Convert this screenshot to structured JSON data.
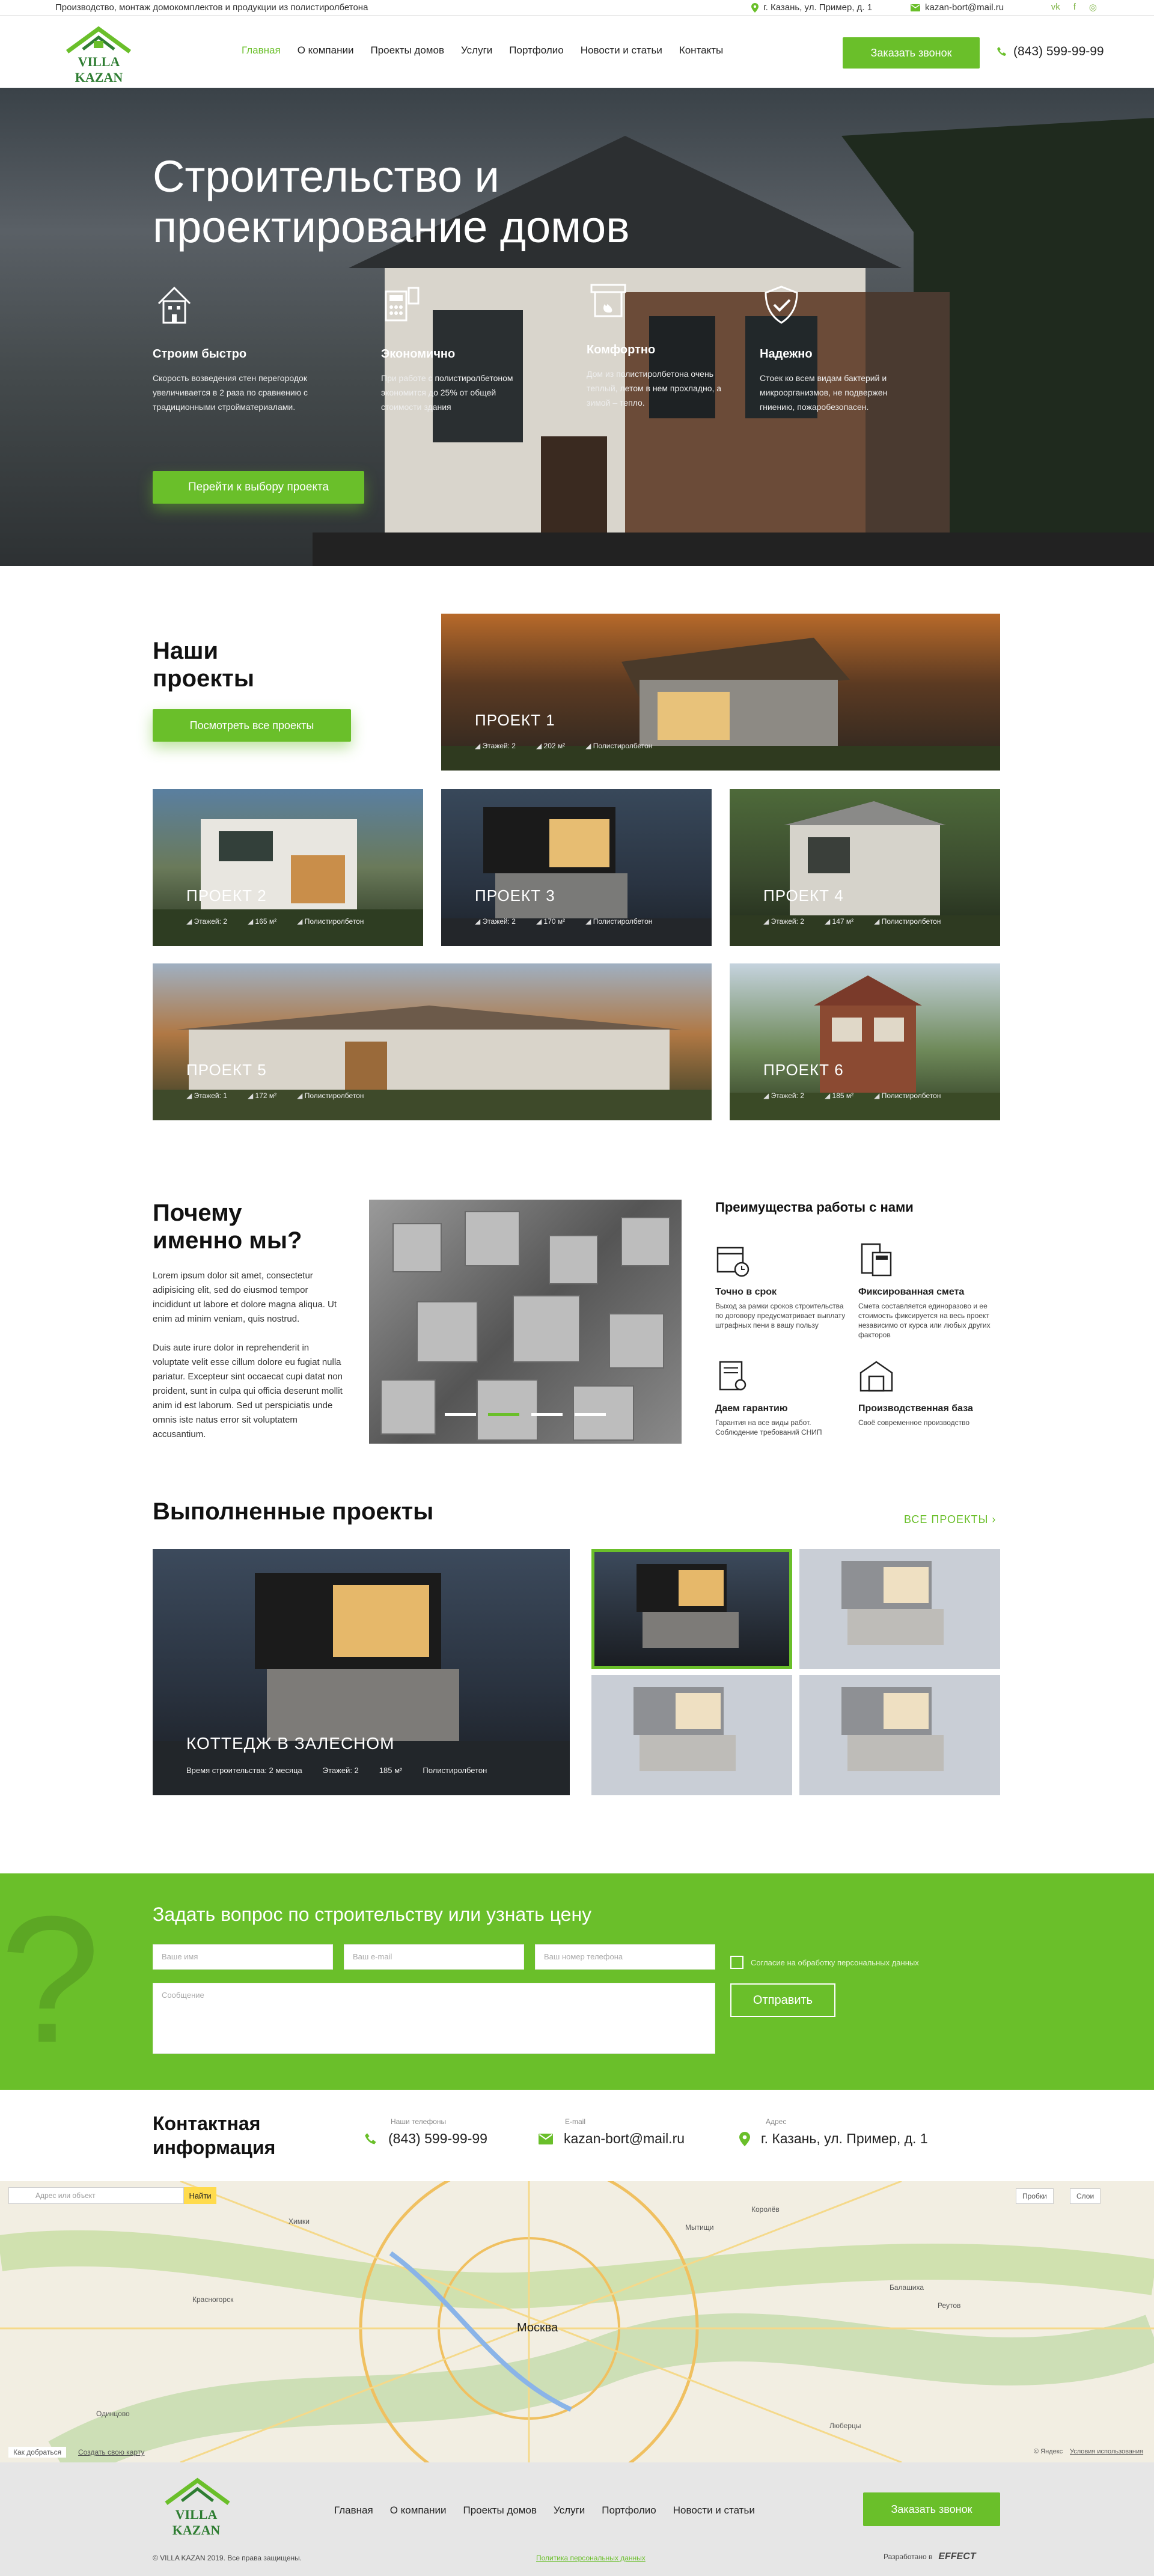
{
  "topbar": {
    "tagline": "Производство, монтаж домокомплектов и продукции из полистиролбетона",
    "address": "г. Казань, ул. Пример, д. 1",
    "email": "kazan-bort@mail.ru",
    "socials": [
      "vk-icon",
      "facebook-icon",
      "instagram-icon"
    ]
  },
  "header": {
    "logo": "VILLA KAZAN",
    "nav": [
      "Главная",
      "О компании",
      "Проекты домов",
      "Услуги",
      "Портфолио",
      "Новости и статьи",
      "Контакты"
    ],
    "call": "Заказать звонок",
    "phone": "(843) 599-99-99"
  },
  "hero": {
    "title": "Строительство и проектирование домов",
    "features": [
      {
        "title": "Строим быстро",
        "text": "Скорость возведения стен перегородок увеличивается в 2 раза по сравнению с традиционными стройматериалами."
      },
      {
        "title": "Экономично",
        "text": "При работе с полистиролбетоном экономится до 25% от общей стоимости здания"
      },
      {
        "title": "Комфортно",
        "text": "Дом из полистиролбетона очень теплый, летом в нем прохладно, а зимой – тепло."
      },
      {
        "title": "Надежно",
        "text": "Стоек ко всем видам бактерий и микроорганизмов, не подвержен гниению, пожаробезопасен."
      }
    ],
    "cta": "Перейти к выбору проекта"
  },
  "projects": {
    "title": "Наши проекты",
    "button": "Посмотреть все проекты",
    "items": [
      {
        "name": "ПРОЕКТ 1",
        "floors": "Этажей: 2",
        "area": "202 м²",
        "material": "Полистиролбетон"
      },
      {
        "name": "ПРОЕКТ 2",
        "floors": "Этажей: 2",
        "area": "165 м²",
        "material": "Полистиролбетон"
      },
      {
        "name": "ПРОЕКТ 3",
        "floors": "Этажей: 2",
        "area": "170 м²",
        "material": "Полистиролбетон"
      },
      {
        "name": "ПРОЕКТ 4",
        "floors": "Этажей: 2",
        "area": "147 м²",
        "material": "Полистиролбетон"
      },
      {
        "name": "ПРОЕКТ 5",
        "floors": "Этажей: 1",
        "area": "172 м²",
        "material": "Полистиролбетон"
      },
      {
        "name": "ПРОЕКТ 6",
        "floors": "Этажей: 2",
        "area": "185 м²",
        "material": "Полистиролбетон"
      }
    ]
  },
  "why": {
    "title": "Почему именно мы?",
    "p1": "Lorem ipsum dolor sit amet, consectetur adipisicing elit, sed do eiusmod tempor incididunt ut labore et dolore magna aliqua. Ut enim ad minim veniam, quis nostrud.",
    "p2": "Duis aute irure dolor in reprehenderit in voluptate velit esse cillum dolore eu fugiat nulla pariatur. Excepteur sint occaecat cupi datat non proident, sunt in culpa qui officia deserunt mollit anim id est laborum. Sed ut perspiciatis unde omnis iste natus error sit voluptatem accusantium."
  },
  "advantages": {
    "title": "Преимущества работы с нами",
    "items": [
      {
        "title": "Точно в срок",
        "text": "Выход за рамки сроков строительства по договору предусматривает выплату штрафных пени в вашу пользу"
      },
      {
        "title": "Фиксированная смета",
        "text": "Смета составляется единоразово и ее стоимость фиксируется на весь проект независимо от курса или любых других факторов"
      },
      {
        "title": "Даем гарантию",
        "text": "Гарантия на все виды работ. Соблюдение требований СНИП"
      },
      {
        "title": "Производственная база",
        "text": "Своё современное производство"
      }
    ]
  },
  "done": {
    "title": "Выполненные проекты",
    "all": "ВСЕ ПРОЕКТЫ",
    "main": {
      "name": "КОТТЕДЖ В ЗАЛЕСНОМ",
      "time": "Время строительства: 2 месяца",
      "floors": "Этажей: 2",
      "area": "185 м²",
      "material": "Полистиролбетон"
    }
  },
  "ask": {
    "title": "Задать вопрос по строительству или узнать цену",
    "name": "Ваше имя",
    "email": "Ваш e-mail",
    "phone": "Ваш номер телефона",
    "message": "Сообщение",
    "consent": "Согласие на обработку персональных данных",
    "send": "Отправить"
  },
  "contacts": {
    "title": "Контактная информация",
    "phone_label": "Наши телефоны",
    "phone": "(843) 599-99-99",
    "email_label": "E-mail",
    "email": "kazan-bort@mail.ru",
    "addr_label": "Адрес",
    "addr": "г. Казань, ул. Пример, д. 1"
  },
  "map": {
    "search": "Адрес или объект",
    "find": "Найти",
    "traffic": "Пробки",
    "layers": "Слои",
    "city": "Москва",
    "labels": [
      "Химки",
      "Мытищи",
      "Королёв",
      "Балашиха",
      "Реутов",
      "Красногорск",
      "Люберцы",
      "Одинцово"
    ],
    "bottom_left": "Как добраться",
    "create": "Создать свою карту",
    "copyright": "© Яндекс",
    "terms": "Условия использования"
  },
  "footer": {
    "logo": "VILLA KAZAN",
    "nav": [
      "Главная",
      "О компании",
      "Проекты домов",
      "Услуги",
      "Портфолио",
      "Новости и статьи"
    ],
    "call": "Заказать звонок",
    "copy": "© VILLA KAZAN 2019. Все права защищены.",
    "policy": "Политика персональных данных",
    "dev": "Разработано в",
    "dev_brand": "EFFECT"
  }
}
